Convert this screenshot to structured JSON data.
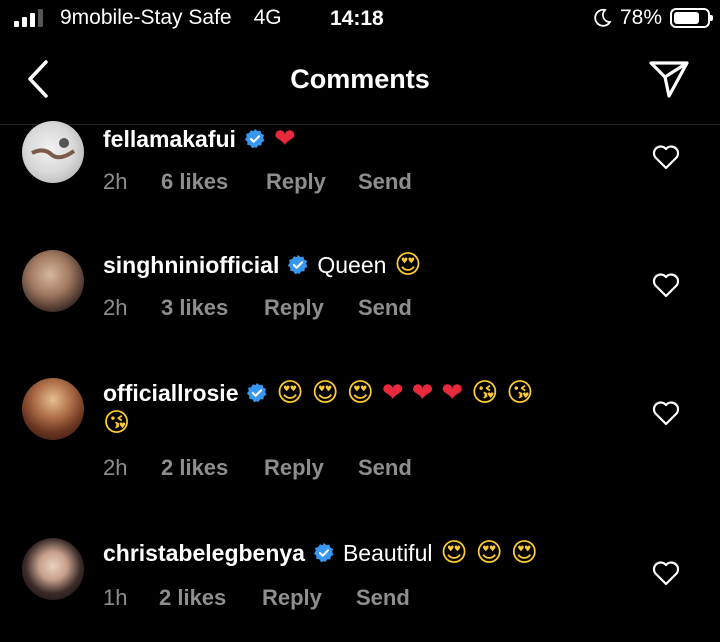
{
  "status_bar": {
    "carrier": "9mobile-Stay Safe",
    "network": "4G",
    "time": "14:18",
    "battery_pct": "78%",
    "battery_level": 0.78
  },
  "header": {
    "title": "Comments"
  },
  "comments": [
    {
      "username": "fellamakafui",
      "verified": true,
      "text": "",
      "emojis": [
        "❤"
      ],
      "time": "2h",
      "likes": "6 likes",
      "reply": "Reply",
      "send": "Send"
    },
    {
      "username": "singhniniofficial",
      "verified": true,
      "text": "Queen",
      "emojis": [
        "😍"
      ],
      "time": "2h",
      "likes": "3 likes",
      "reply": "Reply",
      "send": "Send"
    },
    {
      "username": "officiallrosie",
      "verified": true,
      "text": "",
      "emojis": [
        "😍",
        "😍",
        "😍",
        "❤",
        "❤",
        "❤",
        "😘",
        "😘"
      ],
      "emojis_line2": [
        "😘"
      ],
      "time": "2h",
      "likes": "2 likes",
      "reply": "Reply",
      "send": "Send"
    },
    {
      "username": "christabelegbenya",
      "verified": true,
      "text": "Beautiful",
      "emojis": [
        "😍",
        "😍",
        "😍"
      ],
      "time": "1h",
      "likes": "2 likes",
      "reply": "Reply",
      "send": "Send"
    }
  ],
  "colors": {
    "background": "#000000",
    "meta_gray": "#8e8e8e",
    "verified_blue": "#3897f0",
    "heart_red": "#e8283c"
  }
}
